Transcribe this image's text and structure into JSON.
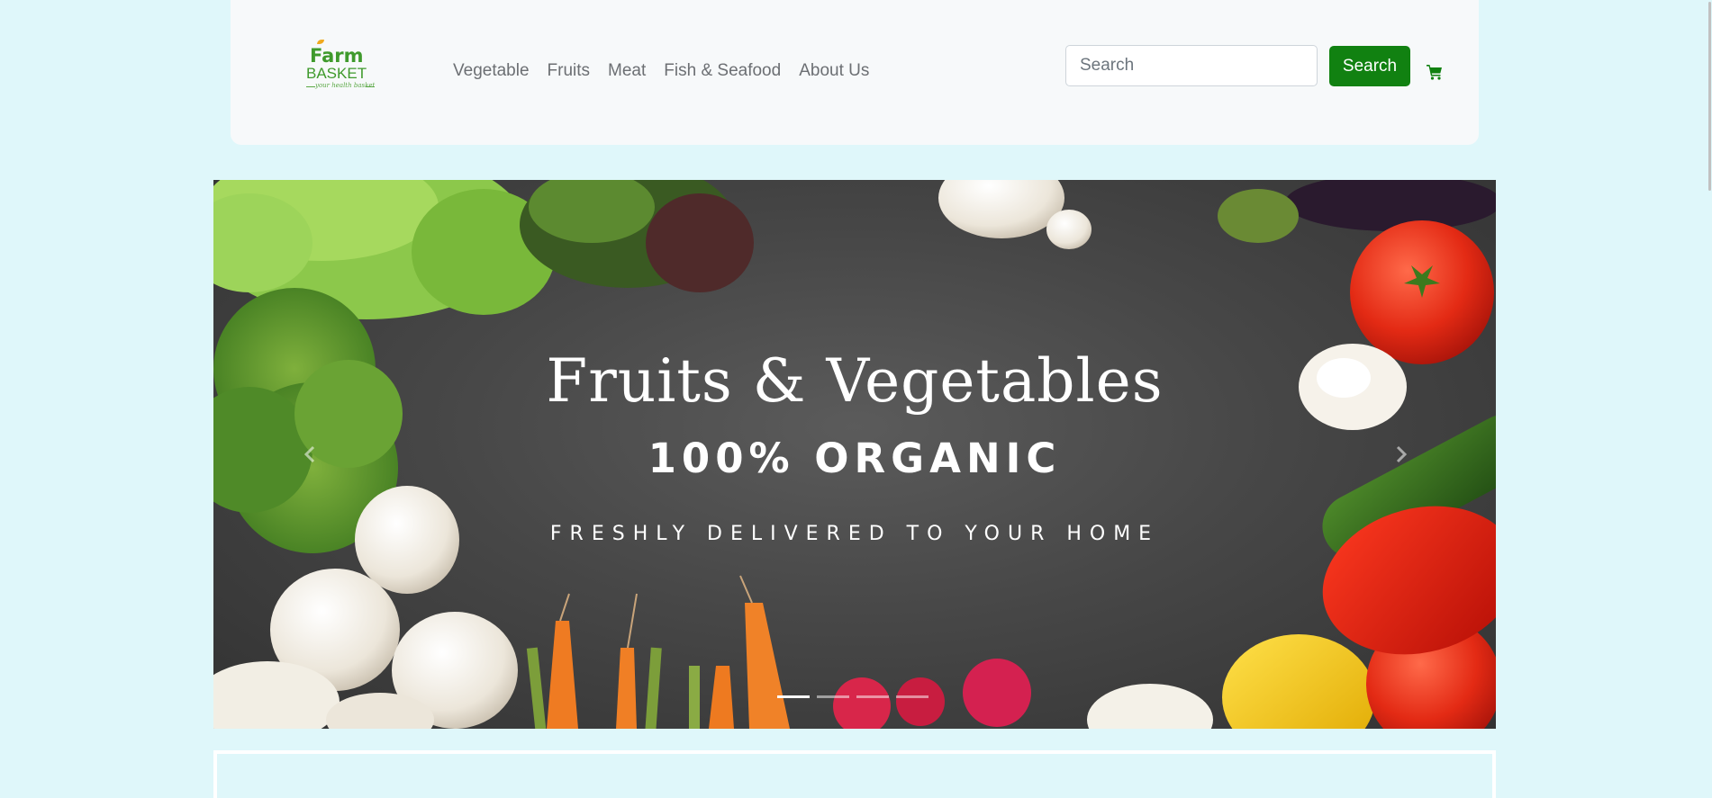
{
  "brand": {
    "line1": "Farm",
    "line2": "BASKET",
    "tagline": "your health basket",
    "colors": {
      "primary": "#3f9a2c",
      "accent": "#f0a91e"
    }
  },
  "nav": {
    "links": [
      "Vegetable",
      "Fruits",
      "Meat",
      "Fish & Seafood",
      "About Us"
    ]
  },
  "search": {
    "placeholder": "Search",
    "value": "",
    "button_label": "Search",
    "button_color": "#118111"
  },
  "cart": {
    "icon": "shopping-cart-icon",
    "color": "#118111"
  },
  "carousel": {
    "title": "Fruits & Vegetables",
    "subtitle": "100% ORGANIC",
    "tagline": "FRESHLY DELIVERED TO YOUR HOME",
    "prev_icon": "chevron-left-icon",
    "next_icon": "chevron-right-icon",
    "slide_count": 4,
    "active_slide": 1
  },
  "theme": {
    "page_background": "#dff7fa",
    "header_background": "#f7f9fa"
  }
}
